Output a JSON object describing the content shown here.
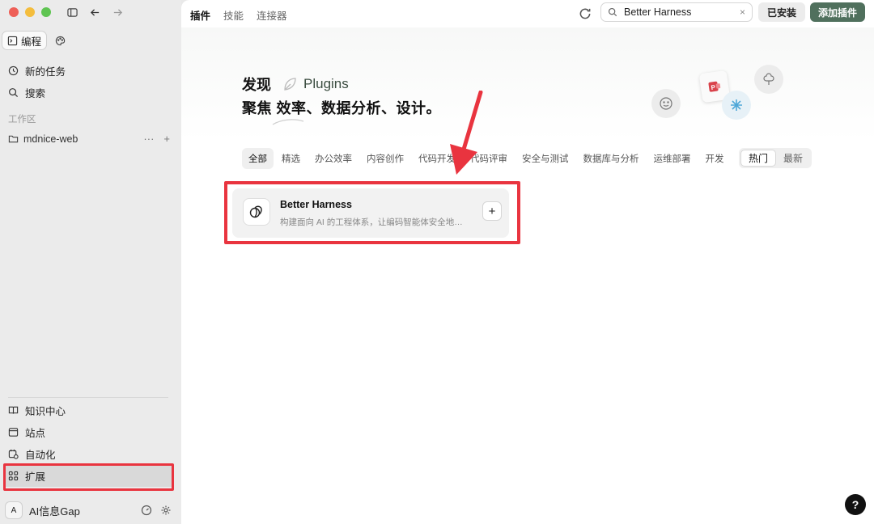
{
  "sidebar": {
    "mode_tabs": [
      {
        "label": "编程"
      },
      {
        "label": ""
      }
    ],
    "nav": [
      {
        "label": "新的任务"
      },
      {
        "label": "搜索"
      }
    ],
    "section_label": "工作区",
    "workspace": {
      "name": "mdnice-web"
    },
    "bottom_nav": [
      {
        "label": "知识中心"
      },
      {
        "label": "站点"
      },
      {
        "label": "自动化"
      },
      {
        "label": "扩展"
      }
    ],
    "user": {
      "avatar": "A",
      "name": "AI信息Gap"
    }
  },
  "main": {
    "tabs": [
      {
        "label": "插件"
      },
      {
        "label": "技能"
      },
      {
        "label": "连接器"
      }
    ],
    "search": {
      "value": "Better Harness",
      "clear": "×"
    },
    "installed_label": "已安装",
    "add_plugin_label": "添加插件",
    "hero": {
      "title_cn": "发现",
      "title_en": "Plugins",
      "subtitle": "聚焦 效率、数据分析、设计。"
    },
    "filters": [
      "全部",
      "精选",
      "办公效率",
      "内容创作",
      "代码开发",
      "代码评审",
      "安全与测试",
      "数据库与分析",
      "运维部署",
      "开发"
    ],
    "sort": [
      {
        "label": "热门"
      },
      {
        "label": "最新"
      }
    ],
    "plugin_card": {
      "title": "Better Harness",
      "description": "构建面向 AI 的工程体系，让编码智能体安全地…",
      "add": "+"
    },
    "help": "?"
  },
  "colors": {
    "accent": "#50705d",
    "highlight": "#e9343f"
  }
}
